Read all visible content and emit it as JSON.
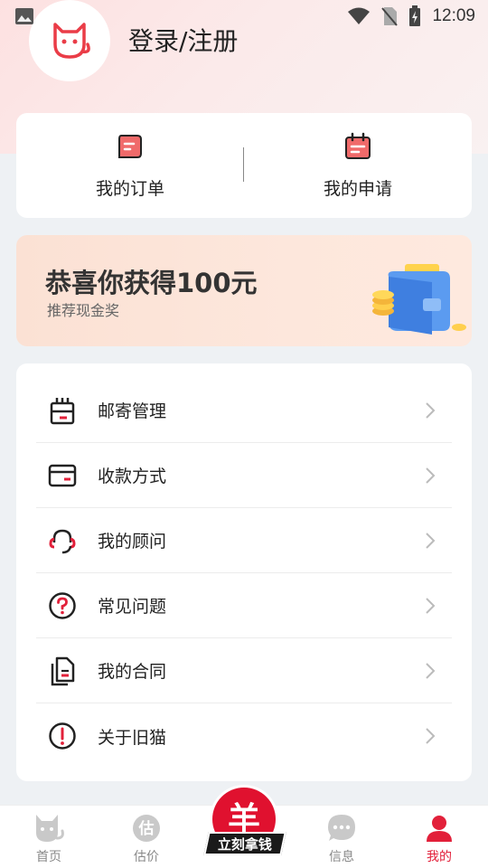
{
  "status_bar": {
    "time": "12:09"
  },
  "header": {
    "login_label": "登录/注册"
  },
  "orders": [
    {
      "label": "我的订单",
      "icon": "order-icon"
    },
    {
      "label": "我的申请",
      "icon": "calendar-icon"
    }
  ],
  "banner": {
    "title": "恭喜你获得100元",
    "subtitle": "推荐现金奖"
  },
  "menu": [
    {
      "label": "邮寄管理",
      "icon": "mail-box-icon"
    },
    {
      "label": "收款方式",
      "icon": "card-icon"
    },
    {
      "label": "我的顾问",
      "icon": "headset-icon"
    },
    {
      "label": "常见问题",
      "icon": "question-icon"
    },
    {
      "label": "我的合同",
      "icon": "contract-icon"
    },
    {
      "label": "关于旧猫",
      "icon": "info-icon"
    }
  ],
  "tabbar": {
    "home": "首页",
    "estimate": "估价",
    "center_badge": "立刻拿钱",
    "center_mark": "羊",
    "messages": "信息",
    "mine": "我的"
  },
  "colors": {
    "accent": "#e2203a",
    "icon_red": "#f05a5a",
    "tab_inactive": "#888888"
  }
}
